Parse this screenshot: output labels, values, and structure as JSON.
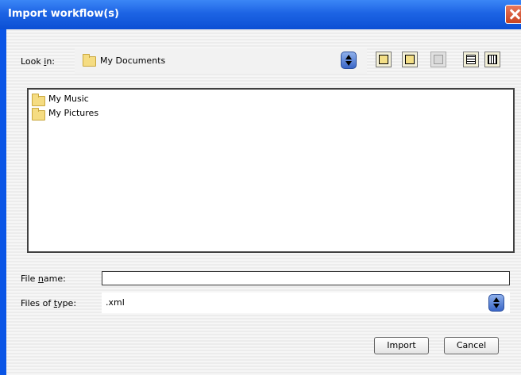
{
  "window": {
    "title": "Import workflow(s)"
  },
  "look_in": {
    "label": "Look in:",
    "value": "My Documents",
    "value_icon": "folder-icon"
  },
  "toolbar": {
    "buttons": [
      {
        "name": "up-one-level",
        "icon": "up-folder-icon"
      },
      {
        "name": "desktop",
        "icon": "home-folder-icon"
      },
      {
        "name": "create-new-folder",
        "icon": "new-folder-icon",
        "disabled": true
      },
      {
        "name": "list-view",
        "icon": "list-view-icon"
      },
      {
        "name": "details-view",
        "icon": "details-view-icon"
      }
    ]
  },
  "file_list": {
    "items": [
      {
        "name": "My Music",
        "icon": "folder-icon"
      },
      {
        "name": "My Pictures",
        "icon": "folder-icon"
      }
    ]
  },
  "file_name": {
    "label": "File name:",
    "value": ""
  },
  "files_of_type": {
    "label": "Files of type:",
    "value": ".xml"
  },
  "buttons": {
    "import": "Import",
    "cancel": "Cancel"
  },
  "colors": {
    "title_bar": "#0b4fd4",
    "close_button": "#d45a35",
    "folder": "#f5dc82"
  }
}
